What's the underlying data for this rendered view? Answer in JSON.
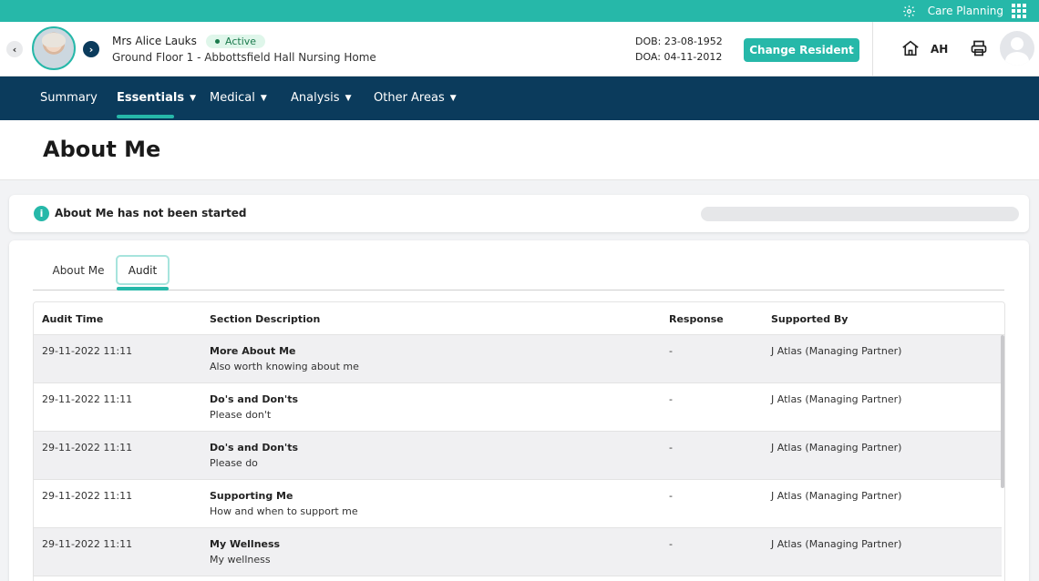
{
  "topbar": {
    "app_name": "Care Planning",
    "icons": [
      "gear-icon",
      "apps-grid-icon"
    ]
  },
  "resident": {
    "name": "Mrs Alice Lauks",
    "status": "Active",
    "location": "Ground Floor 1 - Abbottsfield Hall Nursing Home",
    "dob": "DOB: 23-08-1952",
    "doa": "DOA: 04-11-2012",
    "change_button": "Change Resident"
  },
  "user": {
    "initials": "AH"
  },
  "nav": {
    "items": [
      {
        "label": "Summary",
        "dropdown": false
      },
      {
        "label": "Essentials",
        "dropdown": true
      },
      {
        "label": "Medical",
        "dropdown": true
      },
      {
        "label": "Analysis",
        "dropdown": true
      },
      {
        "label": "Other Areas",
        "dropdown": true
      }
    ],
    "active": "Essentials"
  },
  "page": {
    "title": "About Me"
  },
  "status": {
    "message": "About Me has not been started",
    "progress_fraction": 0
  },
  "tabs": {
    "items": [
      "About Me",
      "Audit"
    ],
    "active": "Audit"
  },
  "table": {
    "headers": [
      "Audit Time",
      "Section Description",
      "Response",
      "Supported By"
    ],
    "rows": [
      {
        "time": "29-11-2022 11:11",
        "section": "More About Me",
        "sub": "Also worth knowing about me",
        "response": "-",
        "supported_by": "J Atlas (Managing Partner)"
      },
      {
        "time": "29-11-2022 11:11",
        "section": "Do's and Don'ts",
        "sub": "Please don't",
        "response": "-",
        "supported_by": "J Atlas (Managing Partner)"
      },
      {
        "time": "29-11-2022 11:11",
        "section": "Do's and Don'ts",
        "sub": "Please do",
        "response": "-",
        "supported_by": "J Atlas (Managing Partner)"
      },
      {
        "time": "29-11-2022 11:11",
        "section": "Supporting Me",
        "sub": "How and when to support me",
        "response": "-",
        "supported_by": "J Atlas (Managing Partner)"
      },
      {
        "time": "29-11-2022 11:11",
        "section": "My Wellness",
        "sub": "My wellness",
        "response": "-",
        "supported_by": "J Atlas (Managing Partner)"
      }
    ]
  },
  "colors": {
    "accent": "#26b8a9",
    "nav_bg": "#0b3b5c",
    "active_badge_bg": "#dff6ea"
  }
}
